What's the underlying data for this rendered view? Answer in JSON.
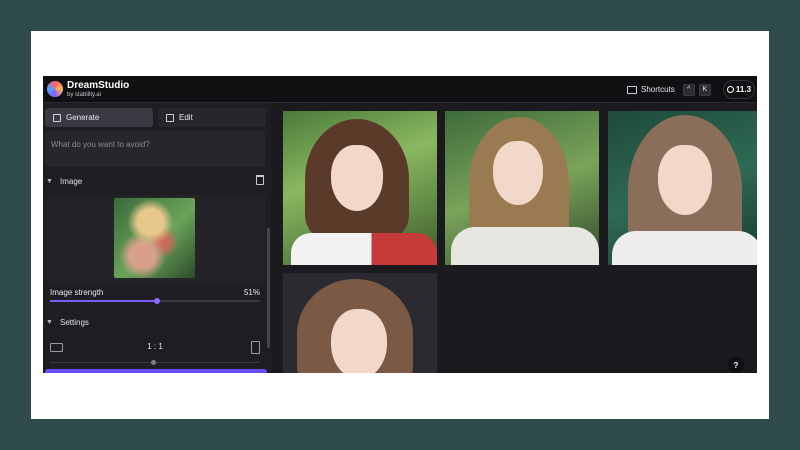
{
  "header": {
    "brand": "DreamStudio",
    "brand_sub": "by stability.ai",
    "shortcuts_label": "Shortcuts",
    "keys": [
      "^",
      "K"
    ],
    "credits": "11.3"
  },
  "sidebar": {
    "tabs": [
      {
        "label": "Generate",
        "icon": "generate-icon",
        "active": true
      },
      {
        "label": "Edit",
        "icon": "edit-icon",
        "active": false
      }
    ],
    "negative_prompt": {
      "placeholder": "What do you want to avoid?"
    },
    "image_section": {
      "title": "Image",
      "strength_label": "Image strength",
      "strength_value": "51%",
      "strength": 0.51
    },
    "settings_section": {
      "title": "Settings",
      "aspect_ratio": "1 : 1",
      "ratio_position": 0.5
    }
  },
  "gallery": {
    "tiles": 4
  },
  "help": {
    "label": "?"
  },
  "colors": {
    "accent": "#7c5cf7",
    "background": "#2f4a4b",
    "panel": "#1d1d22"
  }
}
